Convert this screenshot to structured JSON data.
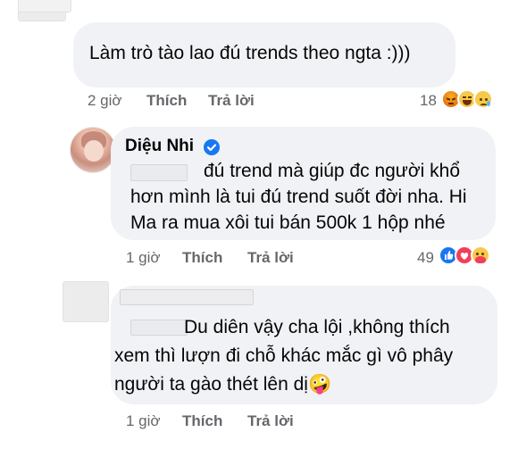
{
  "comments": [
    {
      "text": "Làm trò tào lao đú trends theo ngta :)))",
      "time": "2 giờ",
      "like_label": "Thích",
      "reply_label": "Trả lời",
      "reaction_count": "18",
      "reactions": [
        "angry-icon",
        "haha-icon",
        "sad-icon"
      ]
    },
    {
      "author": "Diệu Nhi",
      "lines": [
        "đú trend mà giúp đc người khổ",
        "hơn mình là tui đú trend suốt đời nha. Hi",
        "Ma ra mua xôi tui bán 500k 1 hộp nhé"
      ],
      "time": "1 giờ",
      "like_label": "Thích",
      "reply_label": "Trả lời",
      "reaction_count": "49",
      "reactions": [
        "like-icon",
        "love-icon",
        "care-icon"
      ]
    },
    {
      "lines": [
        "Du diên vậy cha lội ,không thích",
        "xem thì lượn đi chỗ khác mắc gì vô phây",
        "người ta gào thét lên dị🤪"
      ],
      "time": "1 giờ",
      "like_label": "Thích",
      "reply_label": "Trả lời"
    }
  ],
  "colors": {
    "bubble": "#f0f2f5",
    "meta_text": "#65676b",
    "like_blue": "#1877f2",
    "love_red": "#f33e58"
  }
}
